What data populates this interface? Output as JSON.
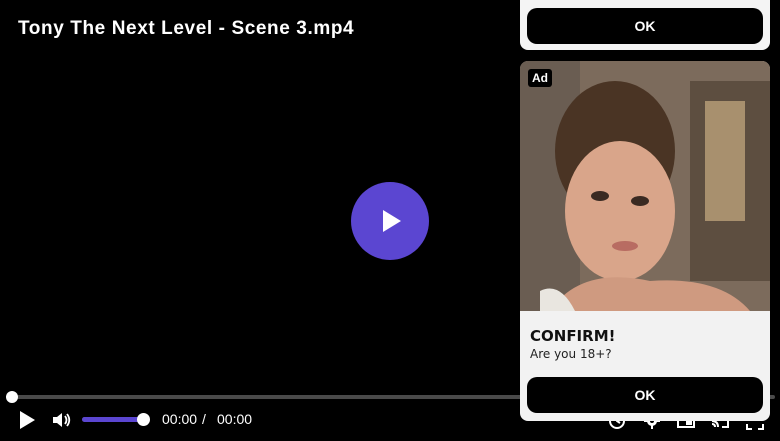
{
  "player": {
    "title": "Tony The Next Level - Scene 3.mp4",
    "accent_color": "#5b46d1",
    "progress_fraction": 0.0,
    "volume_fraction": 1.0,
    "current_time": "00:00",
    "time_separator": "/",
    "duration": "00:00",
    "right_controls": [
      "chapters-icon",
      "settings-gear-icon",
      "picture-in-picture-icon",
      "cast-icon",
      "fullscreen-icon"
    ]
  },
  "ads": {
    "top_card": {
      "button_label": "OK"
    },
    "main_card": {
      "badge": "Ad",
      "image_icon": "photo-icon",
      "headline": "CONFIRM!",
      "body": "Are you 18+?",
      "button_label": "OK"
    }
  }
}
